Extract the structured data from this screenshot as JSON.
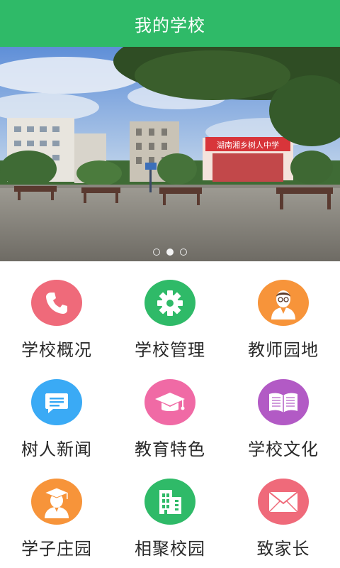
{
  "header": {
    "title": "我的学校"
  },
  "banner": {
    "slide_count": 3,
    "active_index": 1,
    "sign_text": "湖南湘乡树人中学"
  },
  "menu": [
    {
      "label": "学校概况",
      "icon": "phone-icon",
      "color": "#ef6a7a"
    },
    {
      "label": "学校管理",
      "icon": "gear-icon",
      "color": "#2fba68"
    },
    {
      "label": "教师园地",
      "icon": "teacher-icon",
      "color": "#f7943a"
    },
    {
      "label": "树人新闻",
      "icon": "message-icon",
      "color": "#3aaaf5"
    },
    {
      "label": "教育特色",
      "icon": "graduation-cap-icon",
      "color": "#f06aa5"
    },
    {
      "label": "学校文化",
      "icon": "book-icon",
      "color": "#b25ac5"
    },
    {
      "label": "学子庄园",
      "icon": "student-icon",
      "color": "#f7943a"
    },
    {
      "label": "相聚校园",
      "icon": "building-icon",
      "color": "#2fba68"
    },
    {
      "label": "致家长",
      "icon": "mail-icon",
      "color": "#ef6a7a"
    }
  ]
}
